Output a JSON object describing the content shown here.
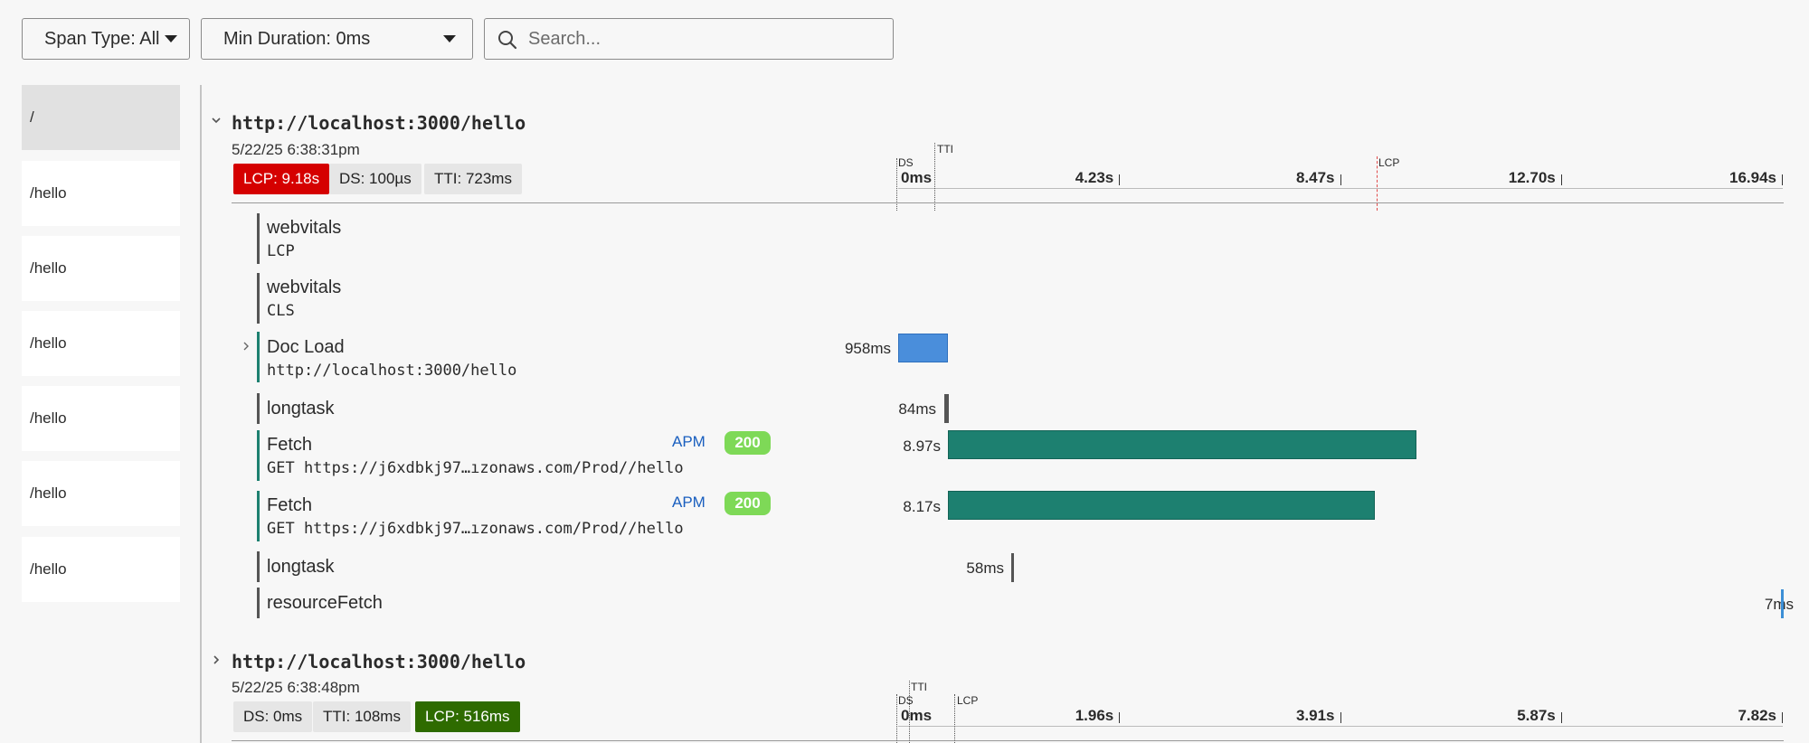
{
  "toolbar": {
    "span_type_label": "Span Type: All",
    "min_duration_label": "Min Duration: 0ms",
    "search_placeholder": "Search..."
  },
  "sidebar": {
    "items": [
      {
        "label": "/",
        "active": true
      },
      {
        "label": "/hello"
      },
      {
        "label": "/hello"
      },
      {
        "label": "/hello"
      },
      {
        "label": "/hello"
      },
      {
        "label": "/hello"
      },
      {
        "label": "/hello"
      }
    ]
  },
  "traces": [
    {
      "title": "http://localhost:3000/hello",
      "date": "5/22/25 6:38:31pm",
      "expanded": true,
      "metrics": [
        {
          "label": "LCP: 9.18s",
          "style": "red"
        },
        {
          "label": "DS: 100µs",
          "style": "gray"
        },
        {
          "label": "TTI: 723ms",
          "style": "gray"
        }
      ],
      "axis": {
        "ticks": [
          "0ms",
          "4.23s",
          "8.47s",
          "12.70s",
          "16.94s"
        ],
        "max_s": 16.94,
        "markers": [
          {
            "label": "DS",
            "at_s": 0.0001
          },
          {
            "label": "TTI",
            "at_s": 0.723
          },
          {
            "label": "LCP",
            "at_s": 9.18
          }
        ]
      },
      "spans": [
        {
          "name": "webvitals",
          "sub": "LCP"
        },
        {
          "name": "webvitals",
          "sub": "CLS"
        },
        {
          "name": "Doc Load",
          "sub": "http://localhost:3000/hello",
          "duration": "958ms",
          "start_s": 0.0,
          "dur_s": 0.958,
          "color": "blue",
          "expandable": true
        },
        {
          "name": "longtask",
          "duration": "84ms",
          "start_s": 0.88,
          "dur_s": 0.084,
          "color": "dark"
        },
        {
          "name": "Fetch",
          "sub": "GET https://j6xdbkj97…ızonaws.com/Prod//hello",
          "apm": "APM",
          "status": "200",
          "duration": "8.97s",
          "start_s": 0.96,
          "dur_s": 8.97,
          "color": "teal"
        },
        {
          "name": "Fetch",
          "sub": "GET https://j6xdbkj97…ızonaws.com/Prod//hello",
          "apm": "APM",
          "status": "200",
          "duration": "8.17s",
          "start_s": 0.96,
          "dur_s": 8.17,
          "color": "teal"
        },
        {
          "name": "longtask",
          "duration": "58ms",
          "start_s": 2.16,
          "dur_s": 0.058,
          "color": "dark"
        },
        {
          "name": "resourceFetch",
          "duration": "7ms",
          "start_s": 16.92,
          "dur_s": 0.007,
          "color": "lblue"
        }
      ]
    },
    {
      "title": "http://localhost:3000/hello",
      "date": "5/22/25 6:38:48pm",
      "expanded": false,
      "metrics": [
        {
          "label": "DS: 0ms",
          "style": "gray"
        },
        {
          "label": "TTI: 108ms",
          "style": "gray"
        },
        {
          "label": "LCP: 516ms",
          "style": "green"
        }
      ],
      "axis": {
        "ticks": [
          "0ms",
          "1.96s",
          "3.91s",
          "5.87s",
          "7.82s"
        ],
        "max_s": 7.82,
        "markers": [
          {
            "label": "DS",
            "at_s": 0.0
          },
          {
            "label": "TTI",
            "at_s": 0.108
          },
          {
            "label": "LCP",
            "at_s": 0.516
          }
        ]
      }
    }
  ]
}
